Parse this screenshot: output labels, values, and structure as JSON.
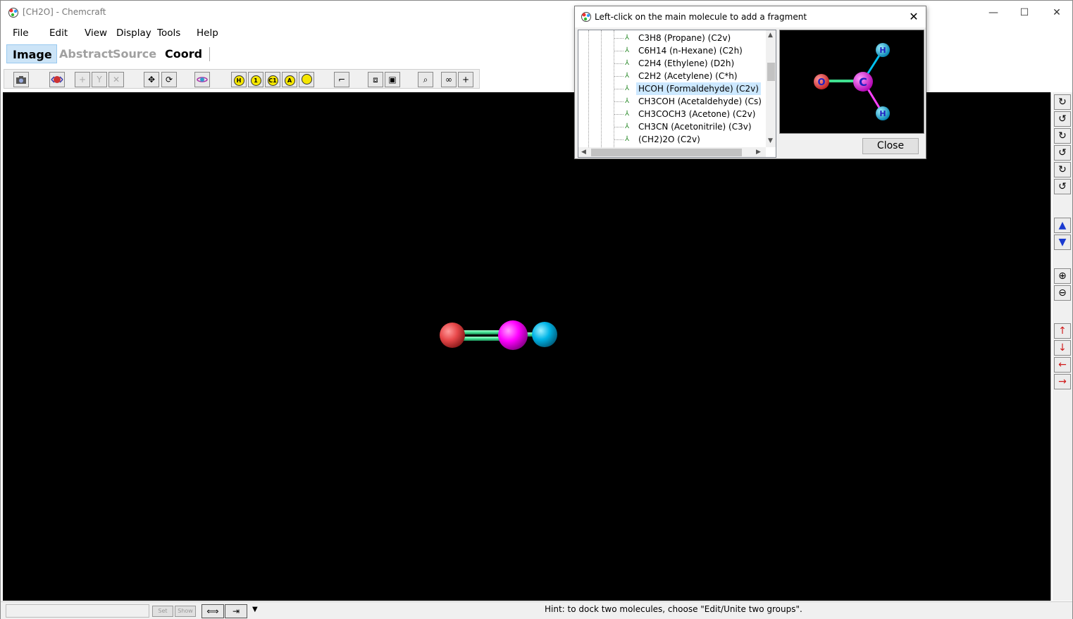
{
  "window": {
    "title": "[CH2O] - Chemcraft",
    "minimize": "—",
    "maximize": "☐",
    "close": "✕"
  },
  "menu": [
    "File",
    "Edit",
    "View",
    "Display",
    "Tools",
    "Help"
  ],
  "modes": [
    {
      "label": "Image",
      "state": "active"
    },
    {
      "label": "Abstract",
      "state": "disabled"
    },
    {
      "label": "Source",
      "state": "disabled"
    },
    {
      "label": "Coord",
      "state": "normal"
    }
  ],
  "toolbar": {
    "labels": {
      "h": "H",
      "one": "1",
      "c1": "C1",
      "a": "A"
    }
  },
  "molecule": {
    "atoms": [
      {
        "element": "O",
        "color": "#e8484a"
      },
      {
        "element": "C",
        "color": "#ff00ff"
      },
      {
        "element": "H",
        "color": "#00b4e6"
      }
    ],
    "bond_color": "#40e090"
  },
  "dialog": {
    "title": "Left-click on the main molecule to add a fragment",
    "close_icon": "✕",
    "close_button": "Close",
    "fragments": [
      "C3H8 (Propane) (C2v)",
      "C6H14 (n-Hexane) (C2h)",
      "C2H4 (Ethylene) (D2h)",
      "C2H2 (Acetylene) (C*h)",
      "HCOH (Formaldehyde) (C2v)",
      "CH3COH (Acetaldehyde) (Cs)",
      "CH3COCH3 (Acetone) (C2v)",
      "CH3CN (Acetonitrile) (C3v)",
      "(CH2)2O (C2v)"
    ],
    "selected_index": 4,
    "preview_labels": {
      "o": "O",
      "c": "C",
      "h1": "H",
      "h2": "H"
    }
  },
  "statusbar": {
    "set": "Set",
    "show": "Show",
    "hint": "Hint: to dock two molecules, choose \"Edit/Unite two groups\"."
  }
}
